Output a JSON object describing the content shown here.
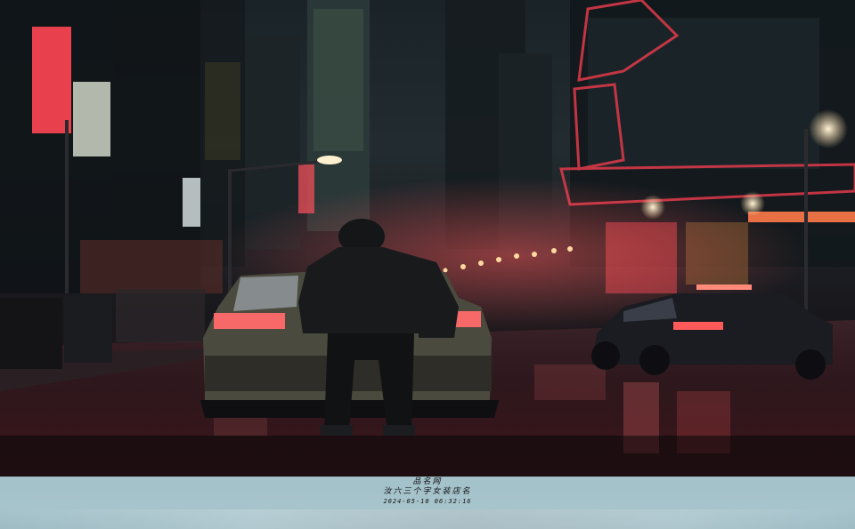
{
  "photo": {
    "subject": "night-city-street-scene",
    "colors": {
      "neon_red": "#e23a4a",
      "sky": "#1f2a2e",
      "road": "#121115",
      "caption_bg": "#a5c2ca"
    }
  },
  "caption": {
    "site": "品名网",
    "slogan": "汝六三个字女装店名",
    "timestamp": "2024-05-10 06:32:16"
  }
}
